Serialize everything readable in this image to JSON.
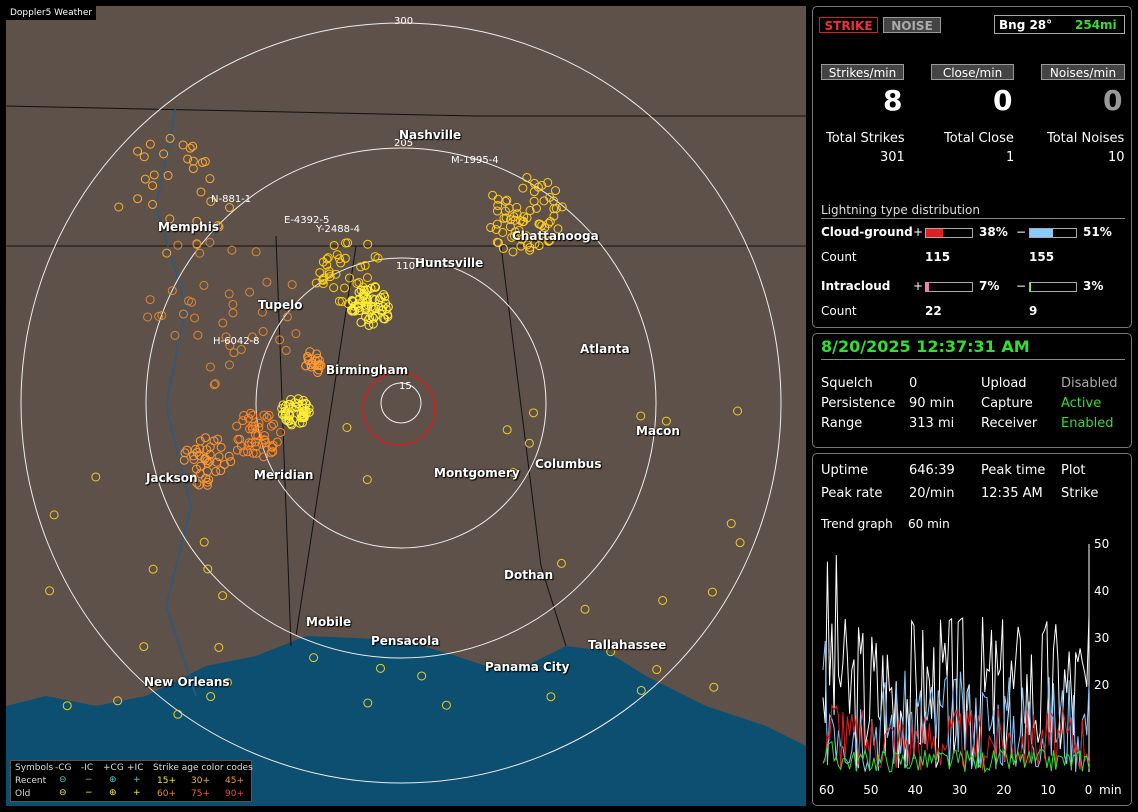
{
  "map": {
    "title": "Doppler5 Weather",
    "cities": [
      "Nashville",
      "Memphis",
      "Chattanooga",
      "Huntsville",
      "Tupelo",
      "Atlanta",
      "Birmingham",
      "Macon",
      "Jackson",
      "Meridian",
      "Montgomery",
      "Columbus",
      "Dothan",
      "Mobile",
      "Pensacola",
      "Tallahassee",
      "Panama City",
      "New Orleans"
    ],
    "ring_labels": [
      "300",
      "205",
      "110",
      "15"
    ],
    "flash_labels": [
      "M-1995-4",
      "N-881-1",
      "E-4392-5",
      "Y-2488-4",
      "H-6042-8"
    ],
    "legend": {
      "symbols_label": "Symbols",
      "cols": [
        "-CG",
        "-IC",
        "+CG",
        "+IC"
      ],
      "recent": "Recent",
      "old": "Old",
      "age_title": "Strike age color codes",
      "age_codes": [
        "15+",
        "30+",
        "45+",
        "60+",
        "75+",
        "90+"
      ]
    }
  },
  "top": {
    "strike": "STRIKE",
    "noise": "NOISE",
    "bearing": "Bng 28°",
    "distance": "254mi",
    "rate_headers": [
      "Strikes/min",
      "Close/min",
      "Noises/min"
    ],
    "rates": [
      "8",
      "0",
      "0"
    ],
    "totals_labels": [
      "Total Strikes",
      "Total Close",
      "Total Noises"
    ],
    "totals": [
      "301",
      "1",
      "10"
    ],
    "dist_title": "Lightning type distribution",
    "cg_label": "Cloud-ground",
    "cg_pos_pct": "38%",
    "cg_neg_pct": "51%",
    "cg_pos_count": "115",
    "cg_neg_count": "155",
    "ic_label": "Intracloud",
    "ic_pos_pct": "7%",
    "ic_neg_pct": "3%",
    "ic_pos_count": "22",
    "ic_neg_count": "9",
    "count_label": "Count",
    "plus": "+",
    "minus": "−",
    "cg_pos_frac": 0.38,
    "cg_neg_frac": 0.51,
    "ic_pos_frac": 0.07,
    "ic_neg_frac": 0.03
  },
  "status": {
    "datetime": "8/20/2025 12:37:31 AM",
    "rows": [
      [
        "Squelch",
        "0",
        "Upload",
        "Disabled"
      ],
      [
        "Persistence",
        "90 min",
        "Capture",
        "Active"
      ],
      [
        "Range",
        "313 mi",
        "Receiver",
        "Enabled"
      ]
    ]
  },
  "stats": {
    "rows": [
      [
        "Uptime",
        "646:39",
        "Peak time",
        "Plot"
      ],
      [
        "Peak rate",
        "20/min",
        "12:35 AM",
        "Strike"
      ]
    ],
    "trend_label": "Trend graph",
    "trend_value": "60 min",
    "y_ticks": [
      "50",
      "40",
      "30",
      "20"
    ],
    "x_ticks": [
      "60",
      "50",
      "40",
      "30",
      "20",
      "10",
      "0"
    ],
    "x_unit": "min"
  },
  "colors": {
    "strike_border": "#cc2222",
    "active": "#33dd33",
    "map_bg": "#5e5149",
    "water": "#0d4f70"
  }
}
